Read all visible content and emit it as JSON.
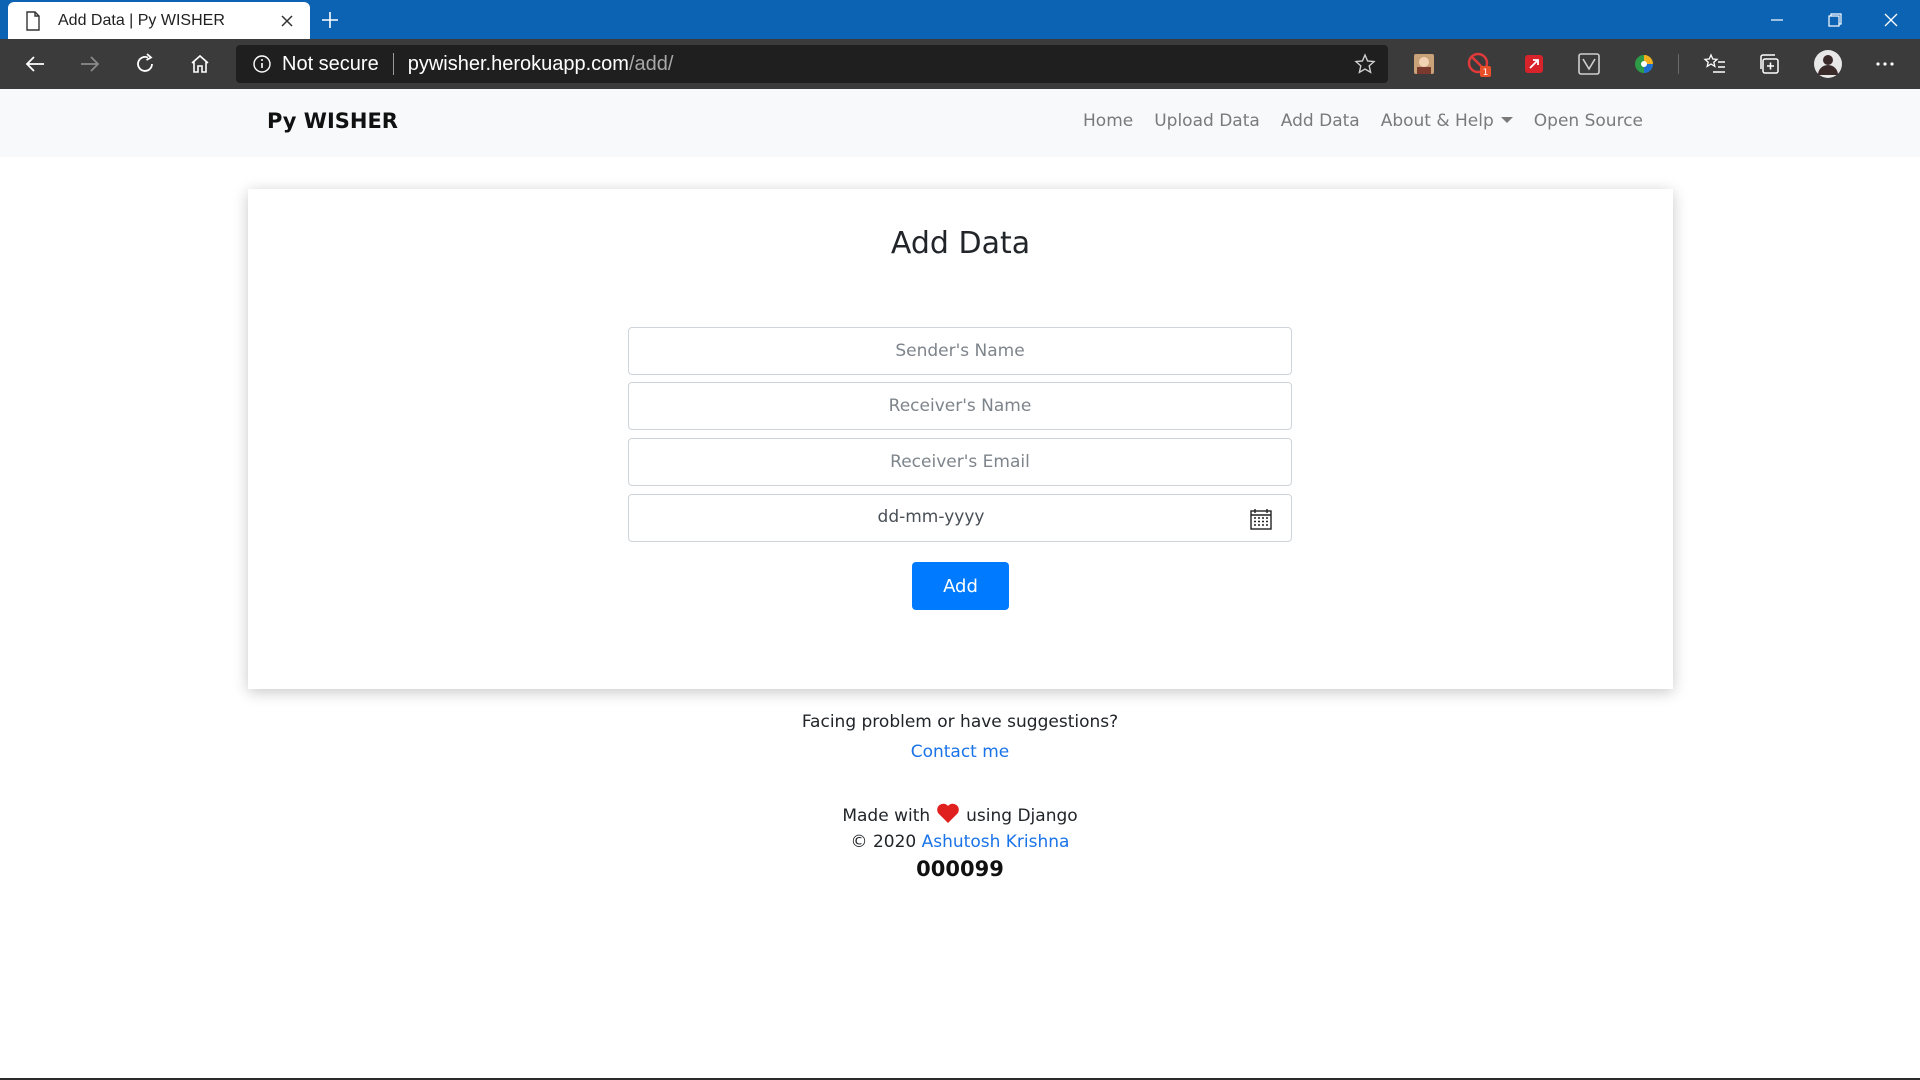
{
  "browser": {
    "tab_title": "Add Data | Py WISHER",
    "security_label": "Not secure",
    "url_host": "pywisher.herokuapp.com",
    "url_path": "/add/",
    "extension_badge": "1"
  },
  "site": {
    "brand": "Py WISHER",
    "nav": {
      "home": "Home",
      "upload": "Upload Data",
      "add": "Add Data",
      "about": "About & Help",
      "open_source": "Open Source"
    }
  },
  "form": {
    "title": "Add Data",
    "sender_placeholder": "Sender's Name",
    "receiver_placeholder": "Receiver's Name",
    "email_placeholder": "Receiver's Email",
    "date_placeholder": "dd-mm-yyyy",
    "submit_label": "Add"
  },
  "footer": {
    "problem_text": "Facing problem or have suggestions?",
    "contact_link": "Contact me",
    "made_with": "Made with",
    "using": "using Django",
    "copyright": "© 2020",
    "author": "Ashutosh Krishna",
    "visitor_count": "000099"
  },
  "colors": {
    "titlebar": "#0c63b4",
    "toolbar": "#3b3b3b",
    "primary": "#007bff",
    "link": "#1a73e8",
    "heart": "#e0201f"
  }
}
